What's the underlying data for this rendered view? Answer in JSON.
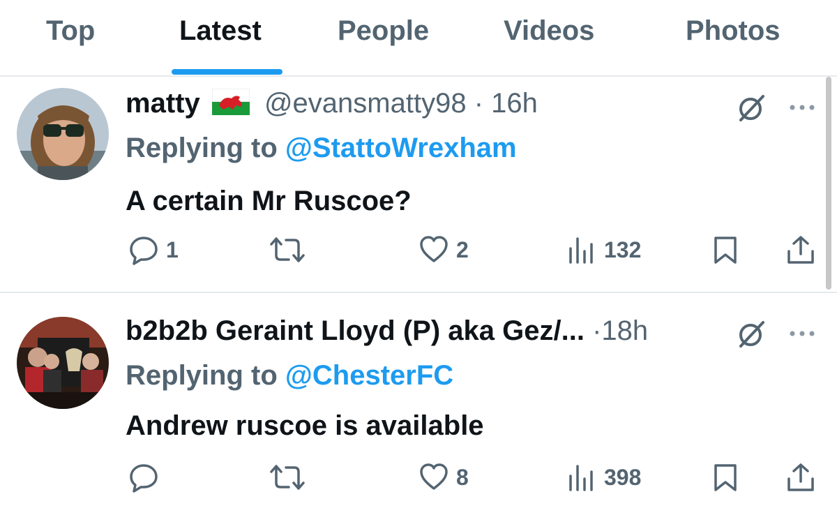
{
  "tabs": [
    {
      "label": "Top",
      "active": false
    },
    {
      "label": "Latest",
      "active": true
    },
    {
      "label": "People",
      "active": false
    },
    {
      "label": "Videos",
      "active": false
    },
    {
      "label": "Photos",
      "active": false
    }
  ],
  "colors": {
    "accent": "#1d9bf0",
    "muted": "#536471",
    "text": "#0f1419",
    "divider": "#e6e9ec"
  },
  "tweets": [
    {
      "name": "matty",
      "flag": "wales-flag-emoji",
      "handle": "@evansmatty98",
      "separator": "·",
      "time": "16h",
      "replying_prefix": "Replying to",
      "replying_to": "@StattoWrexham",
      "text": "A certain Mr Ruscoe?",
      "replies": "1",
      "retweets": "",
      "likes": "2",
      "views": "132"
    },
    {
      "name": "b2b2b Geraint Lloyd (P) aka Gez/...",
      "handle": "",
      "separator": "·",
      "time": "18h",
      "replying_prefix": "Replying to",
      "replying_to": "@ChesterFC",
      "text": "Andrew ruscoe is available",
      "replies": "",
      "retweets": "",
      "likes": "8",
      "views": "398"
    }
  ],
  "icons": {
    "grok": "grok-slash-icon",
    "more": "more-dots-icon",
    "reply": "reply-bubble-icon",
    "retweet": "retweet-icon",
    "like": "heart-icon",
    "views": "views-bar-chart-icon",
    "bookmark": "bookmark-icon",
    "share": "share-icon"
  }
}
